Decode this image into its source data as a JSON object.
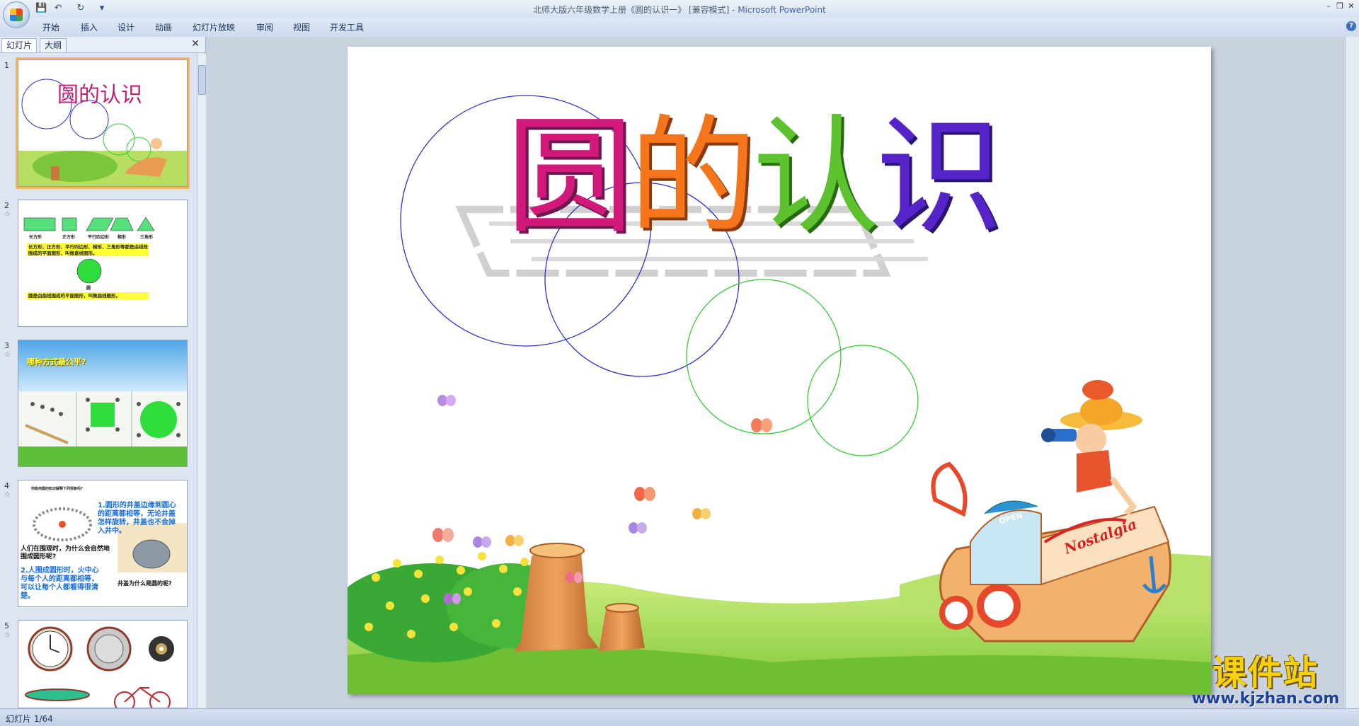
{
  "window": {
    "title_doc": "北师大版六年级数学上册《圆的认识一》 [兼容模式] - ",
    "title_app": "Microsoft PowerPoint",
    "minimize": "–",
    "restore": "❐",
    "close": "✕"
  },
  "quick_access": {
    "save": "💾",
    "undo": "↶",
    "redo": "↻",
    "more": "▾"
  },
  "ribbon": {
    "tabs": [
      "开始",
      "插入",
      "设计",
      "动画",
      "幻灯片放映",
      "审阅",
      "视图",
      "开发工具"
    ],
    "help": "?"
  },
  "left_panel": {
    "tabs": [
      "幻灯片",
      "大纲"
    ],
    "close": "✕",
    "thumbnails": [
      {
        "num": "1",
        "title": "圆的认识"
      },
      {
        "num": "2",
        "labels": [
          "长方形",
          "正方形",
          "平行四边形",
          "梯形",
          "三角形"
        ],
        "text1": "长方形、正方形、平行四边形、梯形、三角形等都是由线段围成的平面图形，叫做直线图形。",
        "circle_label": "圆",
        "text2": "圆是由曲线围成的平面图形，叫做曲线图形。"
      },
      {
        "num": "3",
        "title": "哪种方式最公平?"
      },
      {
        "num": "4",
        "heading": "你能用圆的知识解释下列现象吗?",
        "text1": "1.圆形的井盖边缘到圆心的距离都相等，无论井盖怎样旋转，井盖也不会掉入井中。",
        "text2": "人们在围观时，为什么会自然地围成圆形呢?",
        "text3": "2.人围成圆形时，火中心与每个人的距离都相等，可以让每个人都看得很清楚。",
        "text4": "井盖为什么是圆的呢?"
      },
      {
        "num": "5"
      }
    ]
  },
  "slide": {
    "title_chars": [
      "圆",
      "的",
      "认",
      "识"
    ],
    "boat_text": "Nostalgia",
    "open_text": "OPEN"
  },
  "status": {
    "slide_counter": "幻灯片 1/64"
  },
  "watermark": {
    "main": "课件站",
    "url": "www.kjzhan.com"
  }
}
